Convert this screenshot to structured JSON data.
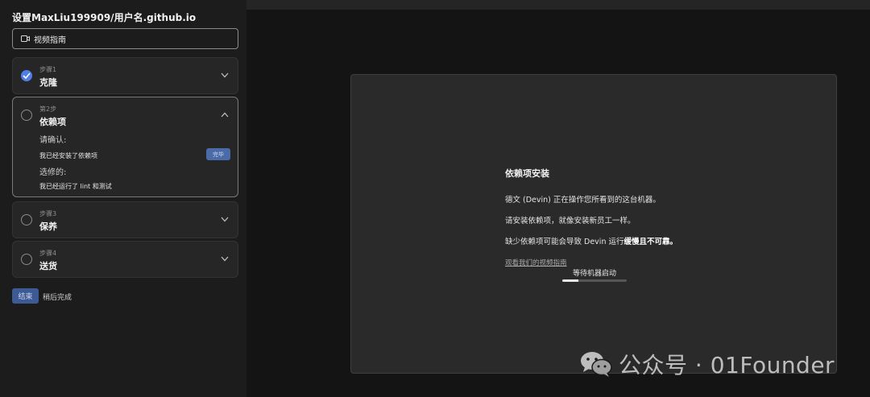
{
  "sidebar": {
    "repo_title": "设置MaxLiu199909/用户名.github.io",
    "video_guide_label": "视频指南",
    "steps": [
      {
        "num": "步骤1",
        "name": "克隆",
        "status": "done"
      },
      {
        "num": "第2步",
        "name": "依赖项",
        "status": "open",
        "confirm_label": "请确认:",
        "required_item": "我已经安装了依赖项",
        "done_button": "完毕",
        "optional_label": "选修的:",
        "optional_item": "我已经运行了 lint 和测试"
      },
      {
        "num": "步骤3",
        "name": "保养",
        "status": "todo"
      },
      {
        "num": "步骤4",
        "name": "送货",
        "status": "todo"
      }
    ],
    "finish_button": "结束",
    "later_link": "稍后完成"
  },
  "panel": {
    "title": "依赖项安装",
    "line1": "德文 (Devin) 正在操作您所看到的这台机器。",
    "line2": "请安装依赖项，就像安装新员工一样。",
    "line3_prefix": "缺少依赖项可能会导致 Devin 运行",
    "line3_bold": "缓慢且不可靠。",
    "video_link": "观看我们的视频指南",
    "waiting_text": "等待机器启动",
    "progress_percent": 25
  },
  "watermark": {
    "text": "公众号 · 01Founder"
  },
  "colors": {
    "accent": "#4f7ee8",
    "button_blue": "#4a6aa8",
    "background": "#1a1a1a",
    "panel": "#2a2a2a"
  }
}
